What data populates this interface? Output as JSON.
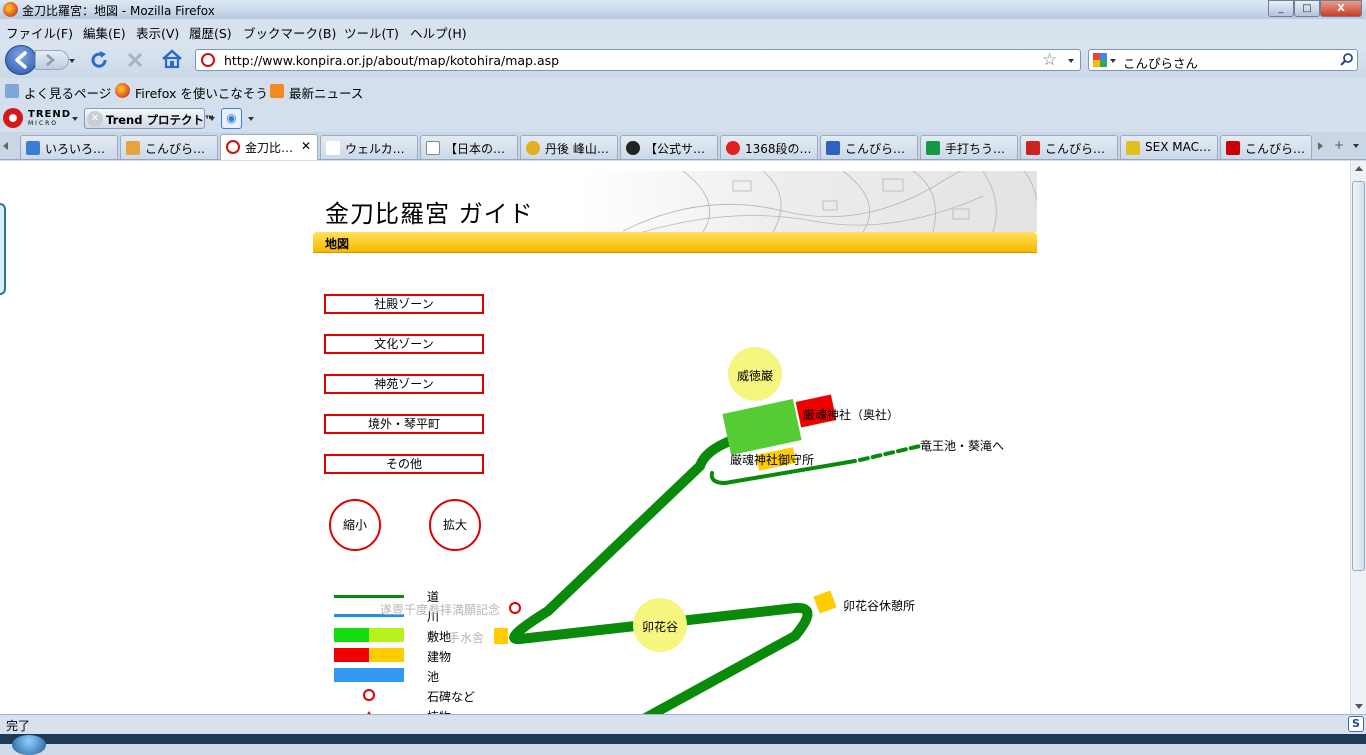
{
  "window": {
    "title": "金刀比羅宮：地図 - Mozilla Firefox",
    "minimize": "_",
    "maximize": "□",
    "close": "X"
  },
  "menu": [
    "ファイル(F)",
    "編集(E)",
    "表示(V)",
    "履歴(S)",
    "ブックマーク(B)",
    "ツール(T)",
    "ヘルプ(H)"
  ],
  "nav": {
    "url": "http://www.konpira.or.jp/about/map/kotohira/map.asp",
    "search_value": "こんぴらさん"
  },
  "bookmarks": [
    "よく見るページ",
    "Firefox を使いこなそう",
    "最新ニュース"
  ],
  "trend": {
    "logo_top": "TREND",
    "logo_bottom": "MICRO",
    "button": "Trend プロテクト™"
  },
  "tabs": [
    {
      "label": "いろいろ…",
      "color": "#3a7fd6"
    },
    {
      "label": "こんぴら…",
      "color": "#e8a33c"
    },
    {
      "label": "金刀比…",
      "color": "#cc1111",
      "active": true
    },
    {
      "label": "ウェルカ…",
      "color": "#ffffff"
    },
    {
      "label": "【日本の…",
      "color": "#ffffff"
    },
    {
      "label": "丹後 峰山…",
      "color": "#e0b020"
    },
    {
      "label": "【公式サ…",
      "color": "#222222"
    },
    {
      "label": "1368段の…",
      "color": "#e02020"
    },
    {
      "label": "こんぴら…",
      "color": "#3060c0"
    },
    {
      "label": "手打ちう…",
      "color": "#119944"
    },
    {
      "label": "こんぴら…",
      "color": "#cc2222"
    },
    {
      "label": "SEX MAC…",
      "color": "#e0c020"
    },
    {
      "label": "こんぴら…",
      "color": "#cc0000"
    }
  ],
  "page": {
    "guide_title": "金刀比羅宮 ガイド",
    "section": "地図",
    "zones": [
      "社殿ゾーン",
      "文化ゾーン",
      "神苑ゾーン",
      "境外・琴平町",
      "その他"
    ],
    "zoom_out": "縮小",
    "zoom_in": "拡大",
    "legend": [
      "道",
      "川",
      "敷地",
      "建物",
      "池",
      "石碑など",
      "植物"
    ],
    "map_labels": {
      "itokuiwa": "威徳巌",
      "okusha": "厳魂神社（奥社）",
      "gomori": "厳魂神社御守所",
      "ryuoike": "竜王池・葵滝へ",
      "unohanadani": "卯花谷",
      "kyukeijo": "卯花谷休憩所",
      "kinen": "遂壹千度参拝満願記念",
      "temizusha": "手水舎"
    }
  },
  "status": {
    "text": "完了"
  }
}
